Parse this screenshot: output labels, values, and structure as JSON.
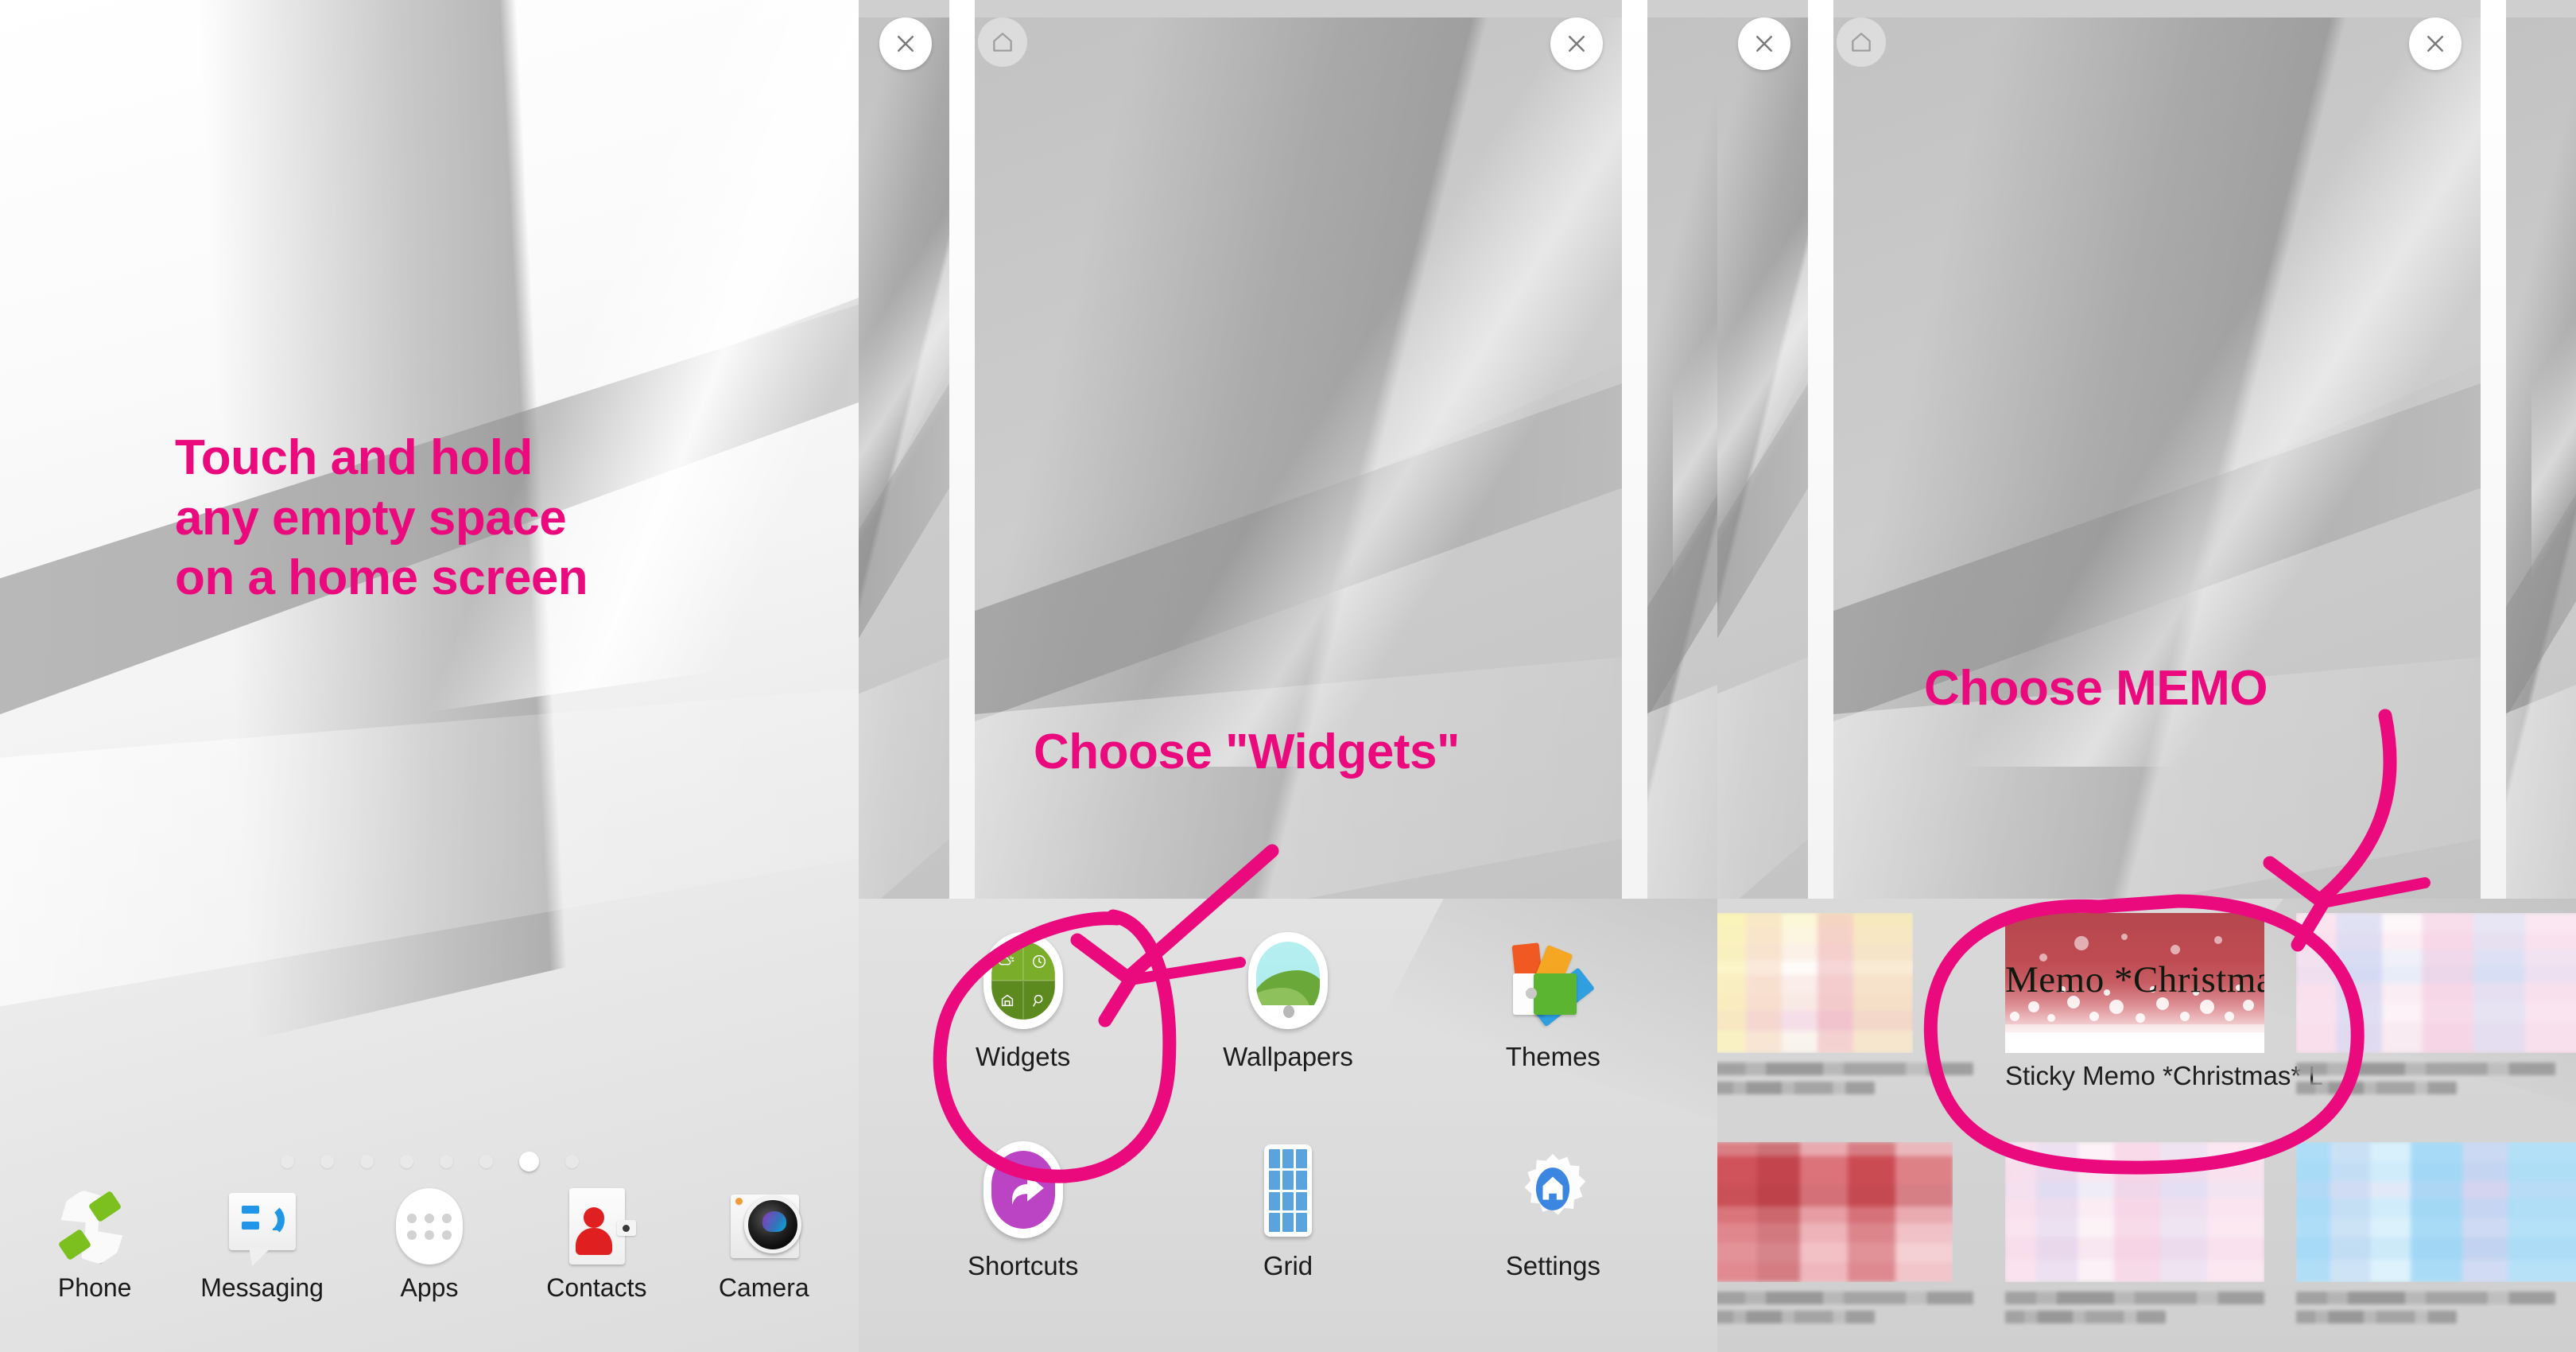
{
  "accent_pink": "#EA0A7E",
  "annotations": {
    "touch_and_hold": "Touch and hold\nany empty space\non a home screen",
    "choose_widgets": "Choose \"Widgets\"",
    "choose_memo": "Choose MEMO"
  },
  "home_screen": {
    "page_indicator": {
      "total": 8,
      "active_index": 6
    },
    "dock": [
      {
        "label": "Phone",
        "icon": "phone-icon"
      },
      {
        "label": "Messaging",
        "icon": "messaging-icon"
      },
      {
        "label": "Apps",
        "icon": "apps-grid-icon"
      },
      {
        "label": "Contacts",
        "icon": "contacts-icon"
      },
      {
        "label": "Camera",
        "icon": "camera-icon"
      }
    ]
  },
  "home_edit_tray": {
    "items": [
      {
        "label": "Widgets",
        "icon": "widgets-icon",
        "highlighted": true
      },
      {
        "label": "Wallpapers",
        "icon": "wallpapers-icon",
        "highlighted": false
      },
      {
        "label": "Themes",
        "icon": "themes-icon",
        "highlighted": false
      },
      {
        "label": "Shortcuts",
        "icon": "shortcuts-icon",
        "highlighted": false
      },
      {
        "label": "Grid",
        "icon": "grid-icon",
        "highlighted": false
      },
      {
        "label": "Settings",
        "icon": "settings-gear-icon",
        "highlighted": false
      }
    ]
  },
  "preview_controls": {
    "close_icon": "close-icon",
    "home_icon": "home-icon"
  },
  "widget_picker": {
    "row1": [
      {
        "name": "",
        "thumb_style": "pastel-yellow-pink",
        "label_blurred": true
      },
      {
        "name": "Sticky Memo *Christmas* L",
        "title": "Memo  *Christmas*",
        "thumb_style": "christmas-red",
        "label_blurred": false,
        "highlighted": true
      },
      {
        "name": "",
        "thumb_style": "pastel-pink-blue",
        "label_blurred": true
      }
    ],
    "row2": [
      {
        "name": "",
        "thumb_style": "red-banner",
        "label_blurred": true
      },
      {
        "name": "",
        "thumb_style": "pastel-pink",
        "label_blurred": true
      },
      {
        "name": "",
        "thumb_style": "pastel-blue",
        "label_blurred": true
      }
    ]
  }
}
